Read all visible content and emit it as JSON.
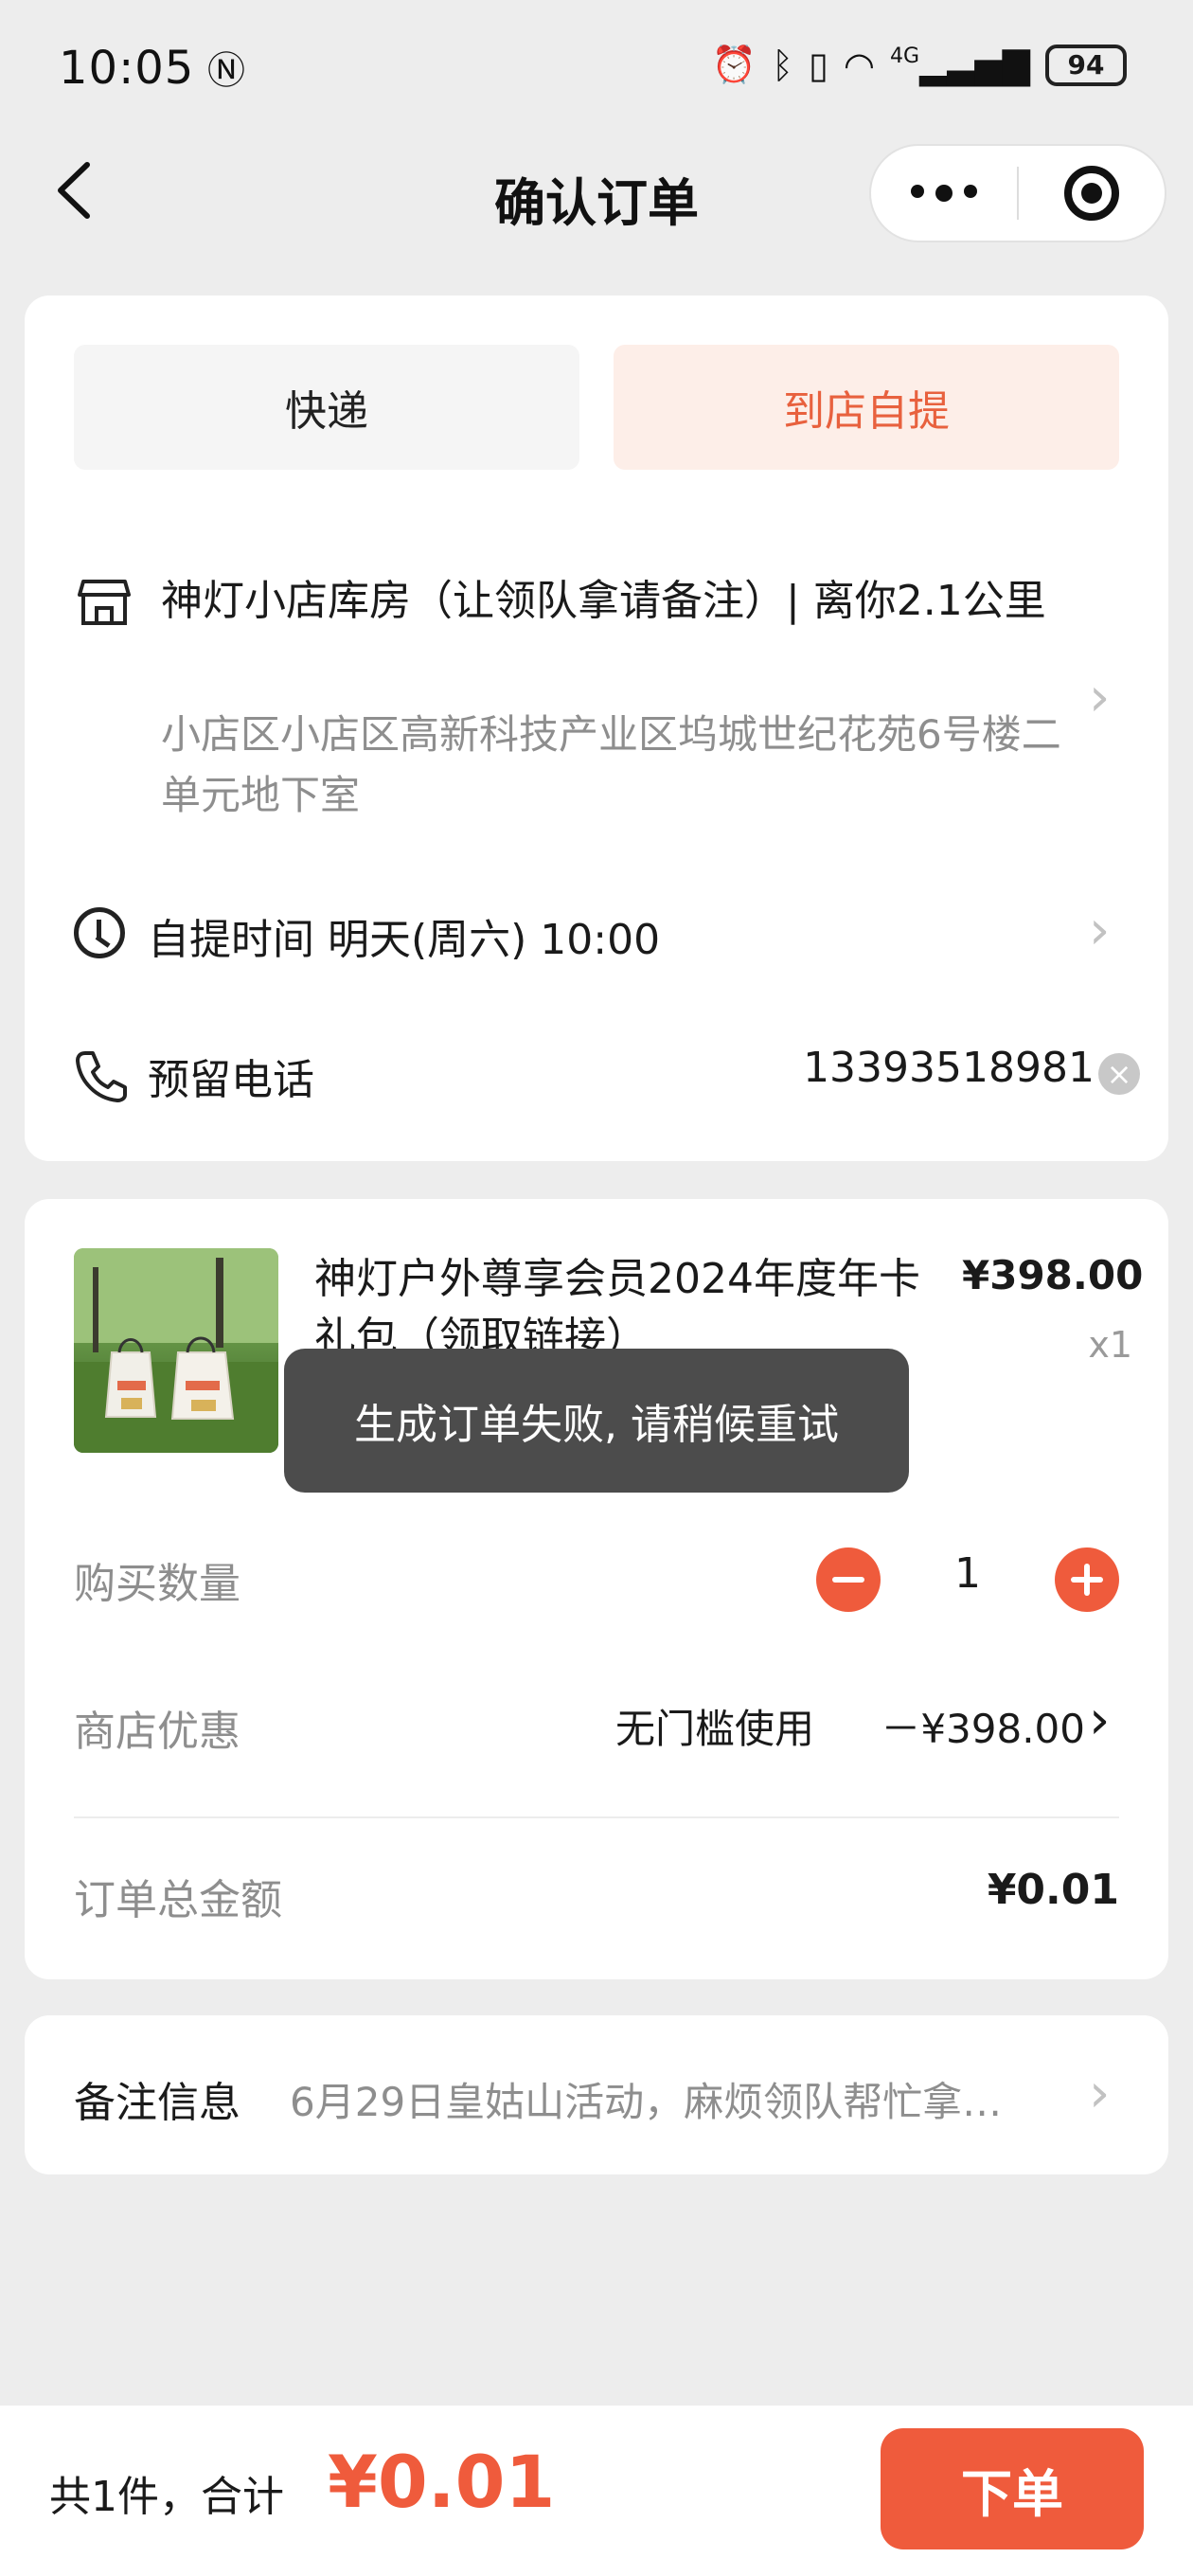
{
  "status_bar": {
    "time": "10:05",
    "nfc_icon": "nfc-icon",
    "signal_label": "4G",
    "battery": "94"
  },
  "header": {
    "title": "确认订单",
    "back_icon": "chevron-left-icon",
    "more_icon": "more-dots-icon",
    "close_icon": "target-circle-icon"
  },
  "delivery": {
    "tabs": [
      {
        "label": "快递",
        "selected": false
      },
      {
        "label": "到店自提",
        "selected": true
      }
    ],
    "store": {
      "name": "神灯小店库房（让领队拿请备注）| 离你2.1公里",
      "address": "小店区小店区高新科技产业区坞城世纪花苑6号楼二单元地下室"
    },
    "pickup_time": "自提时间 明天(周六) 10:00",
    "phone": {
      "label": "预留电话",
      "value": "13393518981"
    }
  },
  "product": {
    "name": "神灯户外尊享会员2024年度年卡礼包（领取链接）",
    "price": "¥398.00",
    "qty_label": "x1",
    "image_icon": "product-thumbnail"
  },
  "toast": {
    "message": "生成订单失败, 请稍候重试"
  },
  "order": {
    "quantity_label": "购买数量",
    "quantity_value": "1",
    "discount_label": "商店优惠",
    "discount_desc": "无门槛使用",
    "discount_amount": "－¥398.00",
    "total_label": "订单总金额",
    "total_value": "¥0.01"
  },
  "remark": {
    "label": "备注信息",
    "text": "6月29日皇姑山活动，麻烦领队帮忙拿…"
  },
  "footer": {
    "summary_label": "共1件，合计",
    "summary_amount": "¥0.01",
    "submit_label": "下单"
  },
  "colors": {
    "accent": "#ef5b3c",
    "pickup_tab_bg": "#fdeee8",
    "page_bg": "#ededed"
  }
}
